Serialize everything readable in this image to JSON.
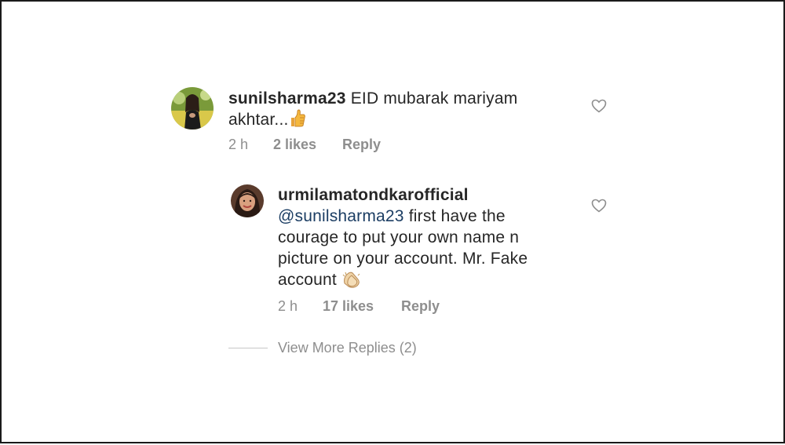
{
  "comment": {
    "username": "sunilsharma23",
    "text_line1": " EID mubarak mariyam",
    "text_line2": "akhtar...",
    "emoji": "thumbs-up-emoji",
    "time": "2 h",
    "likes": "2 likes",
    "reply_label": "Reply"
  },
  "reply": {
    "username": "urmilamatondkarofficial",
    "mention": "@sunilsharma23",
    "text_line1": " first have the",
    "text_line2": "courage to put your own name n",
    "text_line3": "picture on your account. Mr. Fake",
    "text_line4": "account",
    "emoji": "clapping-hands-emoji",
    "time": "2 h",
    "likes": "17 likes",
    "reply_label": "Reply"
  },
  "view_more_replies": "View More Replies (2)",
  "icons": {
    "like": "heart-icon"
  },
  "colors": {
    "text": "#262626",
    "meta": "#8e8e8e",
    "mention": "#1b3d63"
  }
}
